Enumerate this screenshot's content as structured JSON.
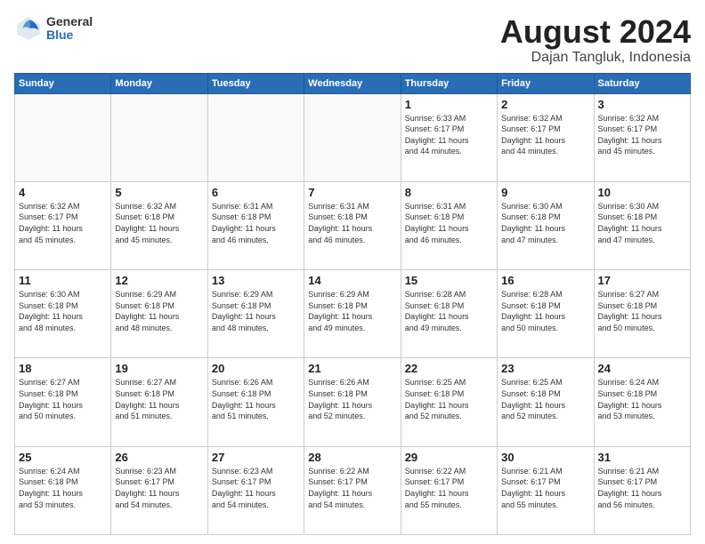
{
  "header": {
    "logo_general": "General",
    "logo_blue": "Blue",
    "title": "August 2024",
    "location": "Dajan Tangluk, Indonesia"
  },
  "days_of_week": [
    "Sunday",
    "Monday",
    "Tuesday",
    "Wednesday",
    "Thursday",
    "Friday",
    "Saturday"
  ],
  "weeks": [
    [
      {
        "day": "",
        "info": ""
      },
      {
        "day": "",
        "info": ""
      },
      {
        "day": "",
        "info": ""
      },
      {
        "day": "",
        "info": ""
      },
      {
        "day": "1",
        "info": "Sunrise: 6:33 AM\nSunset: 6:17 PM\nDaylight: 11 hours\nand 44 minutes."
      },
      {
        "day": "2",
        "info": "Sunrise: 6:32 AM\nSunset: 6:17 PM\nDaylight: 11 hours\nand 44 minutes."
      },
      {
        "day": "3",
        "info": "Sunrise: 6:32 AM\nSunset: 6:17 PM\nDaylight: 11 hours\nand 45 minutes."
      }
    ],
    [
      {
        "day": "4",
        "info": "Sunrise: 6:32 AM\nSunset: 6:17 PM\nDaylight: 11 hours\nand 45 minutes."
      },
      {
        "day": "5",
        "info": "Sunrise: 6:32 AM\nSunset: 6:18 PM\nDaylight: 11 hours\nand 45 minutes."
      },
      {
        "day": "6",
        "info": "Sunrise: 6:31 AM\nSunset: 6:18 PM\nDaylight: 11 hours\nand 46 minutes."
      },
      {
        "day": "7",
        "info": "Sunrise: 6:31 AM\nSunset: 6:18 PM\nDaylight: 11 hours\nand 46 minutes."
      },
      {
        "day": "8",
        "info": "Sunrise: 6:31 AM\nSunset: 6:18 PM\nDaylight: 11 hours\nand 46 minutes."
      },
      {
        "day": "9",
        "info": "Sunrise: 6:30 AM\nSunset: 6:18 PM\nDaylight: 11 hours\nand 47 minutes."
      },
      {
        "day": "10",
        "info": "Sunrise: 6:30 AM\nSunset: 6:18 PM\nDaylight: 11 hours\nand 47 minutes."
      }
    ],
    [
      {
        "day": "11",
        "info": "Sunrise: 6:30 AM\nSunset: 6:18 PM\nDaylight: 11 hours\nand 48 minutes."
      },
      {
        "day": "12",
        "info": "Sunrise: 6:29 AM\nSunset: 6:18 PM\nDaylight: 11 hours\nand 48 minutes."
      },
      {
        "day": "13",
        "info": "Sunrise: 6:29 AM\nSunset: 6:18 PM\nDaylight: 11 hours\nand 48 minutes."
      },
      {
        "day": "14",
        "info": "Sunrise: 6:29 AM\nSunset: 6:18 PM\nDaylight: 11 hours\nand 49 minutes."
      },
      {
        "day": "15",
        "info": "Sunrise: 6:28 AM\nSunset: 6:18 PM\nDaylight: 11 hours\nand 49 minutes."
      },
      {
        "day": "16",
        "info": "Sunrise: 6:28 AM\nSunset: 6:18 PM\nDaylight: 11 hours\nand 50 minutes."
      },
      {
        "day": "17",
        "info": "Sunrise: 6:27 AM\nSunset: 6:18 PM\nDaylight: 11 hours\nand 50 minutes."
      }
    ],
    [
      {
        "day": "18",
        "info": "Sunrise: 6:27 AM\nSunset: 6:18 PM\nDaylight: 11 hours\nand 50 minutes."
      },
      {
        "day": "19",
        "info": "Sunrise: 6:27 AM\nSunset: 6:18 PM\nDaylight: 11 hours\nand 51 minutes."
      },
      {
        "day": "20",
        "info": "Sunrise: 6:26 AM\nSunset: 6:18 PM\nDaylight: 11 hours\nand 51 minutes."
      },
      {
        "day": "21",
        "info": "Sunrise: 6:26 AM\nSunset: 6:18 PM\nDaylight: 11 hours\nand 52 minutes."
      },
      {
        "day": "22",
        "info": "Sunrise: 6:25 AM\nSunset: 6:18 PM\nDaylight: 11 hours\nand 52 minutes."
      },
      {
        "day": "23",
        "info": "Sunrise: 6:25 AM\nSunset: 6:18 PM\nDaylight: 11 hours\nand 52 minutes."
      },
      {
        "day": "24",
        "info": "Sunrise: 6:24 AM\nSunset: 6:18 PM\nDaylight: 11 hours\nand 53 minutes."
      }
    ],
    [
      {
        "day": "25",
        "info": "Sunrise: 6:24 AM\nSunset: 6:18 PM\nDaylight: 11 hours\nand 53 minutes."
      },
      {
        "day": "26",
        "info": "Sunrise: 6:23 AM\nSunset: 6:17 PM\nDaylight: 11 hours\nand 54 minutes."
      },
      {
        "day": "27",
        "info": "Sunrise: 6:23 AM\nSunset: 6:17 PM\nDaylight: 11 hours\nand 54 minutes."
      },
      {
        "day": "28",
        "info": "Sunrise: 6:22 AM\nSunset: 6:17 PM\nDaylight: 11 hours\nand 54 minutes."
      },
      {
        "day": "29",
        "info": "Sunrise: 6:22 AM\nSunset: 6:17 PM\nDaylight: 11 hours\nand 55 minutes."
      },
      {
        "day": "30",
        "info": "Sunrise: 6:21 AM\nSunset: 6:17 PM\nDaylight: 11 hours\nand 55 minutes."
      },
      {
        "day": "31",
        "info": "Sunrise: 6:21 AM\nSunset: 6:17 PM\nDaylight: 11 hours\nand 56 minutes."
      }
    ]
  ]
}
